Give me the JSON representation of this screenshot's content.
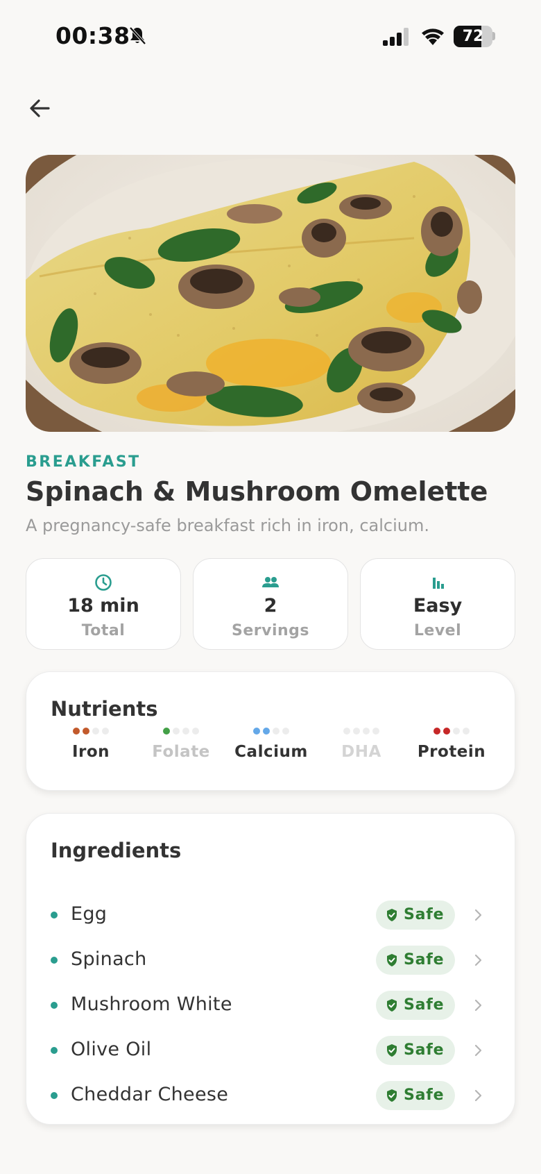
{
  "status_bar": {
    "time": "00:38",
    "battery": "72"
  },
  "recipe": {
    "category": "BREAKFAST",
    "title": "Spinach & Mushroom Omelette",
    "subtitle": "A pregnancy-safe breakfast rich in iron, calcium."
  },
  "info_cards": [
    {
      "icon": "clock-icon",
      "value": "18 min",
      "label": "Total"
    },
    {
      "icon": "people-icon",
      "value": "2",
      "label": "Servings"
    },
    {
      "icon": "bar-chart-icon",
      "value": "Easy",
      "label": "Level"
    }
  ],
  "nutrients": {
    "title": "Nutrients",
    "items": [
      {
        "name": "Iron",
        "level": 2,
        "color": "#c25a2c"
      },
      {
        "name": "Folate",
        "level": 1,
        "color": "#43a047"
      },
      {
        "name": "Calcium",
        "level": 2,
        "color": "#64a8e8"
      },
      {
        "name": "DHA",
        "level": 0,
        "color": "#bdbdbd"
      },
      {
        "name": "Protein",
        "level": 2,
        "color": "#c62828"
      }
    ]
  },
  "ingredients": {
    "title": "Ingredients",
    "items": [
      {
        "name": "Egg",
        "status": "Safe"
      },
      {
        "name": "Spinach",
        "status": "Safe"
      },
      {
        "name": "Mushroom White",
        "status": "Safe"
      },
      {
        "name": "Olive Oil",
        "status": "Safe"
      },
      {
        "name": "Cheddar Cheese",
        "status": "Safe"
      }
    ]
  },
  "colors": {
    "accent": "#2a9d8f",
    "safe_bg": "#e7f1e8",
    "safe_text": "#2e7d32",
    "background": "#f9f8f6"
  }
}
